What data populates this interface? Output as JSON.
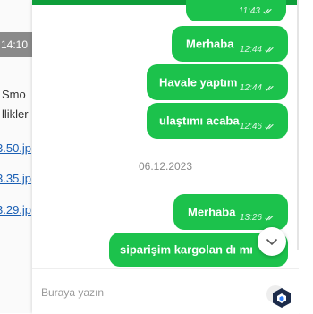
{
  "background_page": {
    "time": "14:10",
    "text_lines": [
      "Smo",
      "llikler"
    ],
    "links": [
      "3.50.jp",
      "3.35.jp",
      "3.29.jp"
    ]
  },
  "chat": {
    "messages": [
      {
        "text": "",
        "time": "11:43"
      },
      {
        "text": "Merhaba",
        "time": "12:44"
      },
      {
        "text": "Havale yaptım",
        "time": "12:44"
      },
      {
        "text": "ulaştımı acaba",
        "time": "12:46"
      },
      {
        "text": "Merhaba",
        "time": "13:26"
      },
      {
        "text": "siparişim kargolan dı mı",
        "time": ""
      }
    ],
    "date_separator": "06.12.2023",
    "input_placeholder": "Buraya yazın",
    "accent_color": "#1cc24c",
    "header_color": "#0e9e3a"
  },
  "icons": {
    "delivered": "double-check-icon",
    "scroll_down": "chevron-down-icon",
    "brand": "chat-logo-icon"
  }
}
